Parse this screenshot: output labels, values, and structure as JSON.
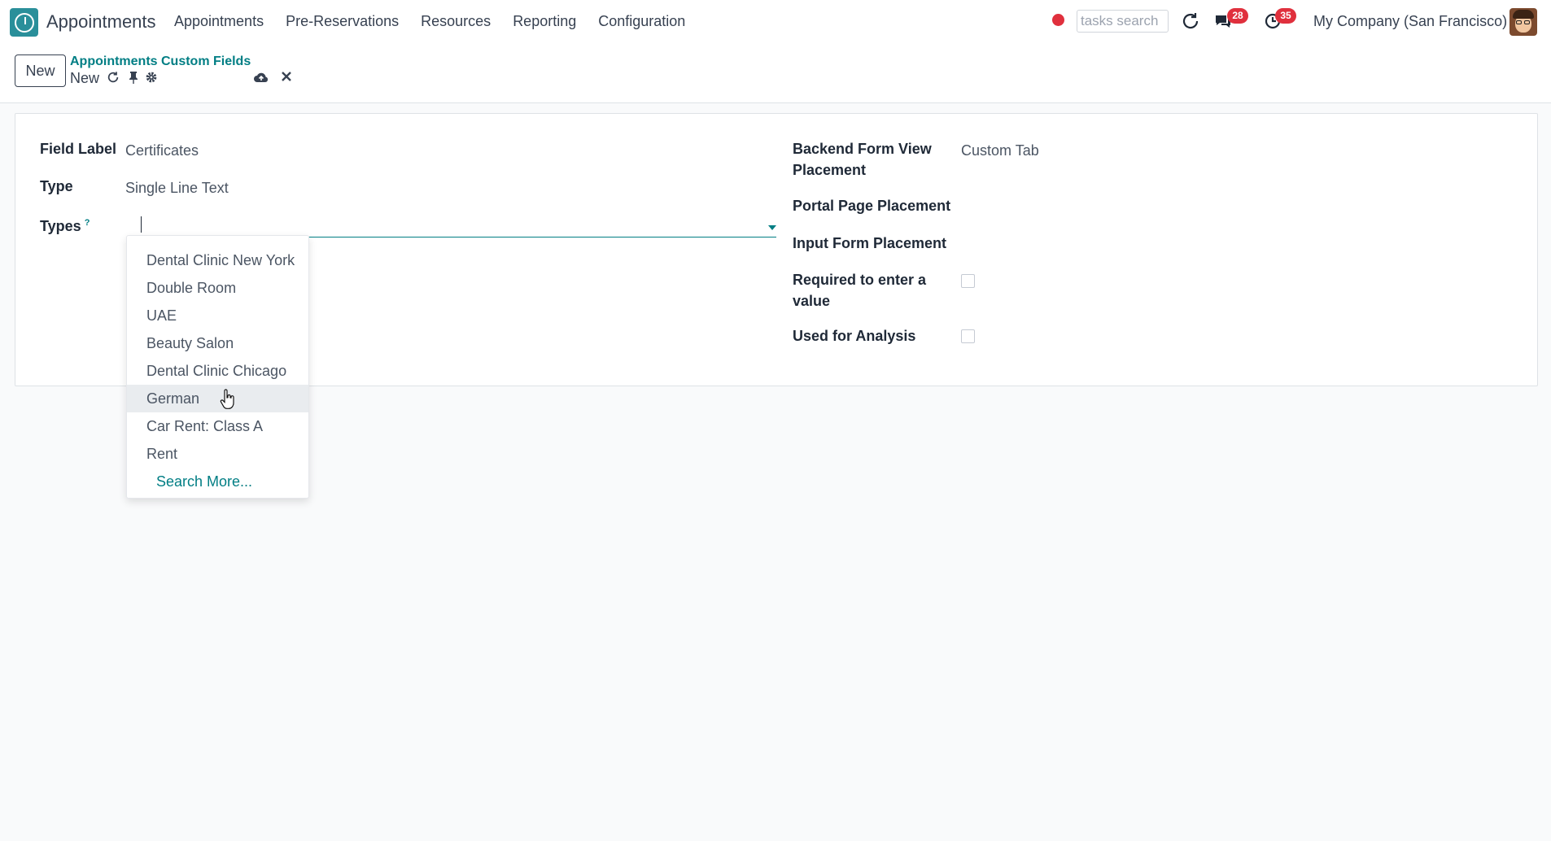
{
  "navbar": {
    "app_name": "Appointments",
    "menu": [
      "Appointments",
      "Pre-Reservations",
      "Resources",
      "Reporting",
      "Configuration"
    ],
    "tasks_search_placeholder": "tasks search",
    "messages_count": "28",
    "activities_count": "35",
    "company": "My Company (San Francisco)"
  },
  "control_panel": {
    "new_button": "New",
    "breadcrumb": "Appointments Custom Fields",
    "record_name": "New"
  },
  "form": {
    "field_label": {
      "label": "Field Label",
      "value": "Certificates"
    },
    "type": {
      "label": "Type",
      "value": "Single Line Text"
    },
    "types": {
      "label": "Types",
      "help": "?",
      "value": ""
    },
    "backend_placement": {
      "label_line1": "Backend Form View",
      "label_line2": "Placement",
      "value": "Custom Tab"
    },
    "portal_placement": {
      "label": "Portal Page Placement",
      "value": ""
    },
    "input_placement": {
      "label": "Input Form Placement",
      "value": ""
    },
    "required": {
      "label_line1": "Required to enter a",
      "label_line2": "value",
      "checked": false
    },
    "used_for_analysis": {
      "label": "Used for Analysis",
      "checked": false
    }
  },
  "dropdown": {
    "items": [
      "Dental Clinic New York",
      "Double Room",
      "UAE",
      "Beauty Salon",
      "Dental Clinic Chicago",
      "German",
      "Car Rent: Class A",
      "Rent"
    ],
    "highlighted_index": 5,
    "search_more": "Search More..."
  },
  "colors": {
    "accent": "#017e84",
    "badge": "#e0303d",
    "logo": "#2a8f9a"
  }
}
